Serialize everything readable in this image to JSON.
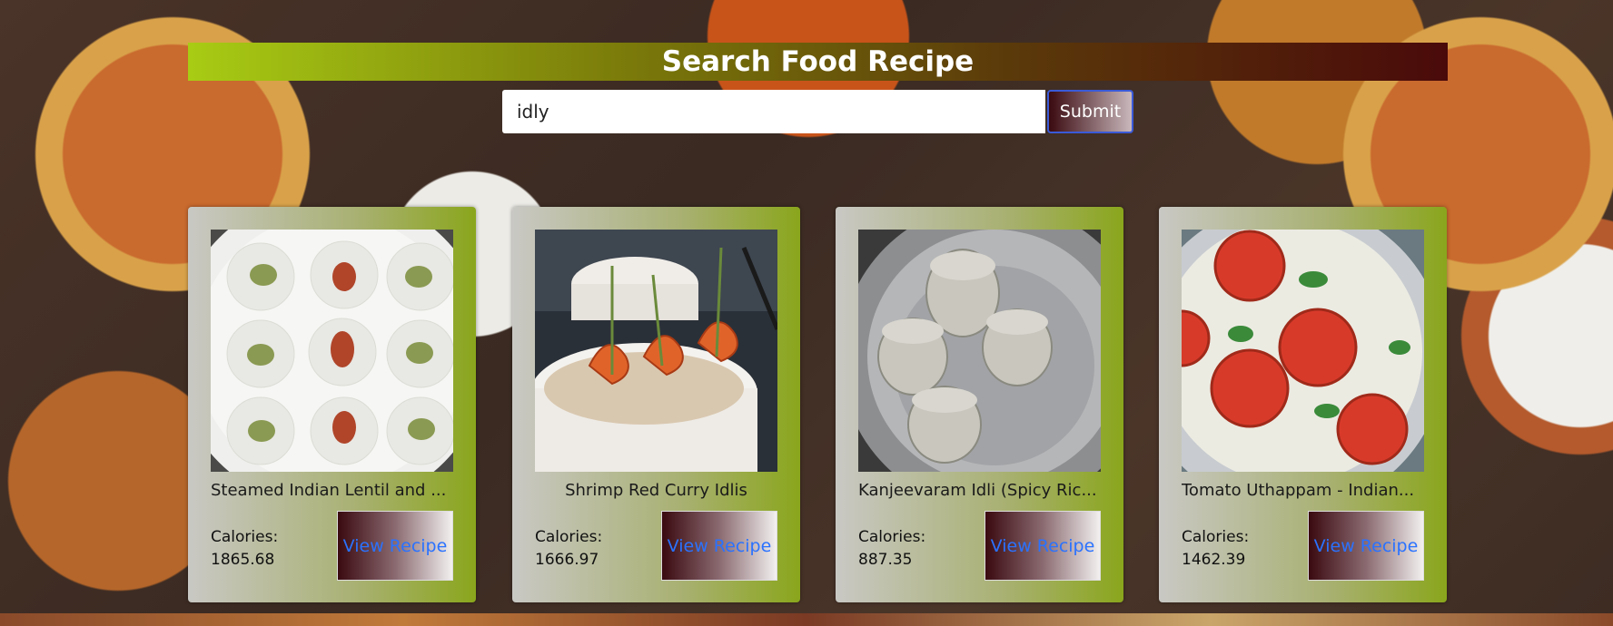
{
  "header": {
    "title": "Search Food Recipe"
  },
  "search": {
    "value": "idly",
    "submit_label": "Submit"
  },
  "cards": [
    {
      "title": "Steamed Indian Lentil and ...",
      "calories_label": "Calories:",
      "calories": "1865.68",
      "button_label": "View Recipe"
    },
    {
      "title": "Shrimp Red Curry Idlis",
      "calories_label": "Calories:",
      "calories": "1666.97",
      "button_label": "View Recipe"
    },
    {
      "title": "Kanjeevaram Idli (Spicy Ric...",
      "calories_label": "Calories:",
      "calories": "887.35",
      "button_label": "View Recipe"
    },
    {
      "title": "Tomato Uthappam - Indian...",
      "calories_label": "Calories:",
      "calories": "1462.39",
      "button_label": "View Recipe"
    }
  ],
  "colors": {
    "title_gradient_start": "#a8cc14",
    "title_gradient_end": "#4a0a0a",
    "link_blue": "#2a72ff",
    "card_green": "#8aa61c"
  }
}
